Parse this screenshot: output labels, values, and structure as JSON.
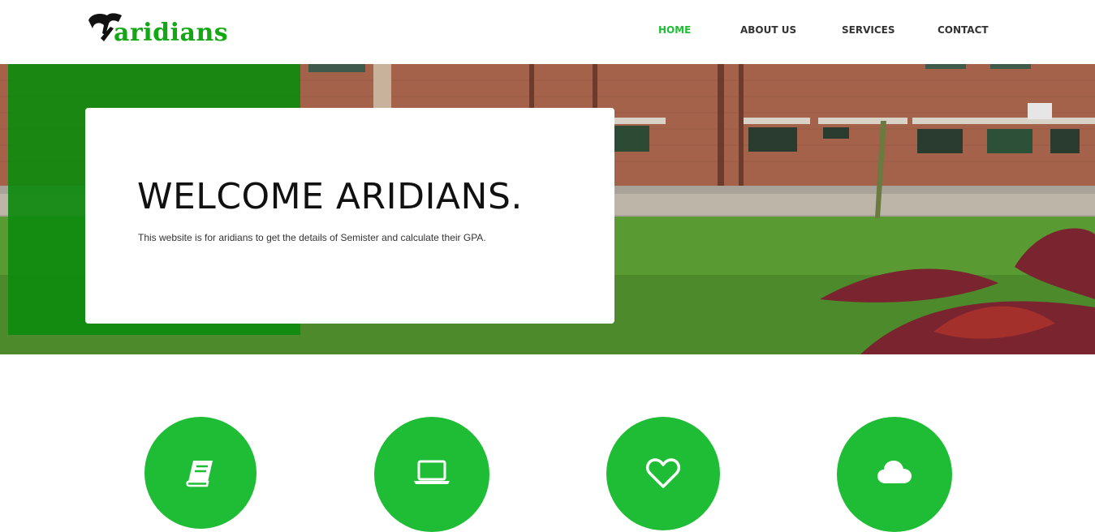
{
  "brand": {
    "name": "aridians"
  },
  "nav": {
    "items": [
      {
        "label": "HOME",
        "active": true
      },
      {
        "label": "ABOUT US",
        "active": false
      },
      {
        "label": "SERVICES",
        "active": false
      },
      {
        "label": "CONTACT",
        "active": false
      }
    ]
  },
  "hero": {
    "title": "WELCOME ARIDIANS.",
    "subtitle": "This website is for aridians to get the details of Semister and calculate their GPA."
  },
  "features": [
    {
      "icon": "book-icon"
    },
    {
      "icon": "laptop-icon"
    },
    {
      "icon": "heart-icon"
    },
    {
      "icon": "cloud-icon"
    }
  ],
  "colors": {
    "accent": "#1fbd35",
    "nav_active": "#1ebf35",
    "logo_text": "#13a813",
    "hero_panel": "#0e8a0e"
  }
}
